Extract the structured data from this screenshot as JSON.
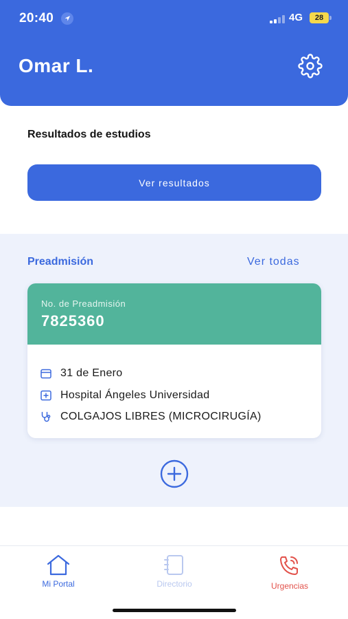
{
  "status_bar": {
    "time": "20:40",
    "network": "4G",
    "battery": "28"
  },
  "header": {
    "user_name": "Omar L."
  },
  "studies": {
    "title": "Resultados de estudios",
    "button_label": "Ver resultados"
  },
  "preadmission": {
    "title": "Preadmisión",
    "see_all": "Ver todas",
    "card": {
      "number_label": "No. de Preadmisión",
      "number": "7825360",
      "date": "31 de Enero",
      "hospital": "Hospital Ángeles Universidad",
      "procedure": "COLGAJOS LIBRES (MICROCIRUGÍA)"
    }
  },
  "tabbar": {
    "items": [
      {
        "label": "Mi Portal",
        "icon": "home-icon",
        "color": "#3b69de"
      },
      {
        "label": "Directorio",
        "icon": "directory-icon",
        "color": "#b9c8ef"
      },
      {
        "label": "Urgencias",
        "icon": "emergency-phone-icon",
        "color": "#e2514a"
      }
    ]
  },
  "colors": {
    "primary": "#3b69de",
    "card_header": "#52b49b",
    "section_bg": "#eef2fc",
    "urgent": "#e2514a"
  }
}
